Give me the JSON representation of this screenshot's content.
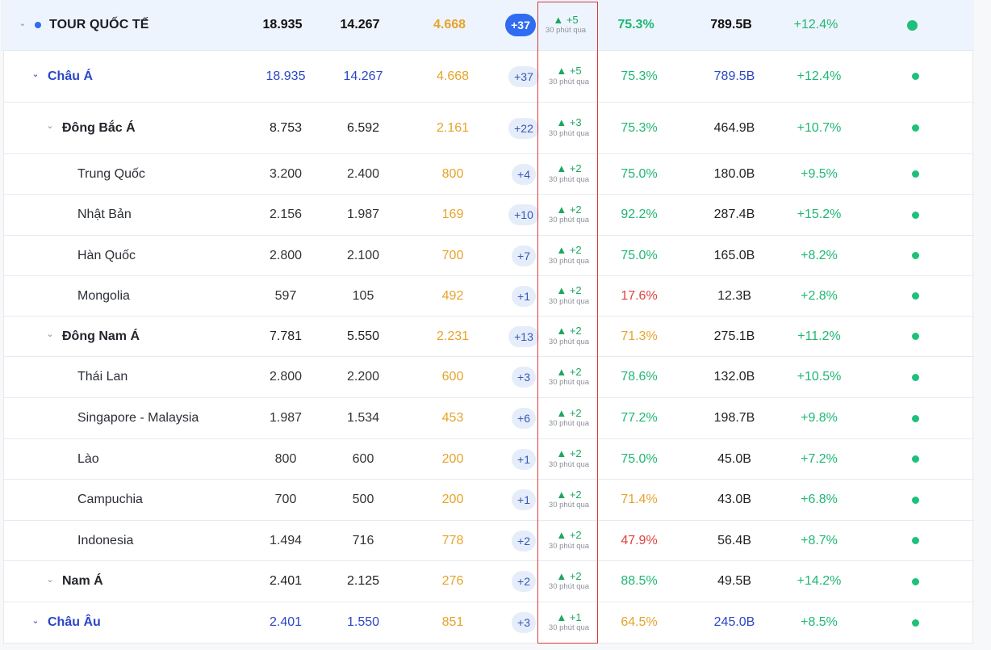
{
  "table": {
    "rows": [
      {
        "name": "TOUR QUỐC TẾ",
        "total": "18.935",
        "booked": "14.267",
        "remaining": "4.668",
        "delta": "+37",
        "trend": "▲ +5",
        "trend_time": "30 phút qua",
        "rate": "75.3%",
        "revenue": "789.5B",
        "growth": "+12.4%"
      },
      {
        "name": "Châu Á",
        "total": "18.935",
        "booked": "14.267",
        "remaining": "4.668",
        "delta": "+37",
        "trend": "▲ +5",
        "trend_time": "30 phút qua",
        "rate": "75.3%",
        "revenue": "789.5B",
        "growth": "+12.4%"
      },
      {
        "name": "Đông Bắc Á",
        "total": "8.753",
        "booked": "6.592",
        "remaining": "2.161",
        "delta": "+22",
        "trend": "▲ +3",
        "trend_time": "30 phút qua",
        "rate": "75.3%",
        "revenue": "464.9B",
        "growth": "+10.7%"
      },
      {
        "name": "Trung Quốc",
        "total": "3.200",
        "booked": "2.400",
        "remaining": "800",
        "delta": "+4",
        "trend": "▲ +2",
        "trend_time": "30 phút qua",
        "rate": "75.0%",
        "revenue": "180.0B",
        "growth": "+9.5%"
      },
      {
        "name": "Nhật Bản",
        "total": "2.156",
        "booked": "1.987",
        "remaining": "169",
        "delta": "+10",
        "trend": "▲ +2",
        "trend_time": "30 phút qua",
        "rate": "92.2%",
        "revenue": "287.4B",
        "growth": "+15.2%"
      },
      {
        "name": "Hàn Quốc",
        "total": "2.800",
        "booked": "2.100",
        "remaining": "700",
        "delta": "+7",
        "trend": "▲ +2",
        "trend_time": "30 phút qua",
        "rate": "75.0%",
        "revenue": "165.0B",
        "growth": "+8.2%"
      },
      {
        "name": "Mongolia",
        "total": "597",
        "booked": "105",
        "remaining": "492",
        "delta": "+1",
        "trend": "▲ +2",
        "trend_time": "30 phút qua",
        "rate": "17.6%",
        "revenue": "12.3B",
        "growth": "+2.8%"
      },
      {
        "name": "Đông Nam Á",
        "total": "7.781",
        "booked": "5.550",
        "remaining": "2.231",
        "delta": "+13",
        "trend": "▲ +2",
        "trend_time": "30 phút qua",
        "rate": "71.3%",
        "revenue": "275.1B",
        "growth": "+11.2%"
      },
      {
        "name": "Thái Lan",
        "total": "2.800",
        "booked": "2.200",
        "remaining": "600",
        "delta": "+3",
        "trend": "▲ +2",
        "trend_time": "30 phút qua",
        "rate": "78.6%",
        "revenue": "132.0B",
        "growth": "+10.5%"
      },
      {
        "name": "Singapore - Malaysia",
        "total": "1.987",
        "booked": "1.534",
        "remaining": "453",
        "delta": "+6",
        "trend": "▲ +2",
        "trend_time": "30 phút qua",
        "rate": "77.2%",
        "revenue": "198.7B",
        "growth": "+9.8%"
      },
      {
        "name": "Lào",
        "total": "800",
        "booked": "600",
        "remaining": "200",
        "delta": "+1",
        "trend": "▲ +2",
        "trend_time": "30 phút qua",
        "rate": "75.0%",
        "revenue": "45.0B",
        "growth": "+7.2%"
      },
      {
        "name": "Campuchia",
        "total": "700",
        "booked": "500",
        "remaining": "200",
        "delta": "+1",
        "trend": "▲ +2",
        "trend_time": "30 phút qua",
        "rate": "71.4%",
        "revenue": "43.0B",
        "growth": "+6.8%"
      },
      {
        "name": "Indonesia",
        "total": "1.494",
        "booked": "716",
        "remaining": "778",
        "delta": "+2",
        "trend": "▲ +2",
        "trend_time": "30 phút qua",
        "rate": "47.9%",
        "revenue": "56.4B",
        "growth": "+8.7%"
      },
      {
        "name": "Nam Á",
        "total": "2.401",
        "booked": "2.125",
        "remaining": "276",
        "delta": "+2",
        "trend": "▲ +2",
        "trend_time": "30 phút qua",
        "rate": "88.5%",
        "revenue": "49.5B",
        "growth": "+14.2%"
      },
      {
        "name": "Châu Âu",
        "total": "2.401",
        "booked": "1.550",
        "remaining": "851",
        "delta": "+3",
        "trend": "▲ +1",
        "trend_time": "30 phút qua",
        "rate": "64.5%",
        "revenue": "245.0B",
        "growth": "+8.5%"
      }
    ]
  },
  "colors": {
    "rate_good": "#1fb773",
    "rate_mid": "#e6a32a",
    "rate_low": "#e0413d",
    "accent": "#2f6cf0",
    "status_dot": "#1fc07a",
    "highlight_border": "#d93a3a"
  },
  "icons": {
    "expand": "chevron-down-icon",
    "status": "status-dot-icon"
  }
}
